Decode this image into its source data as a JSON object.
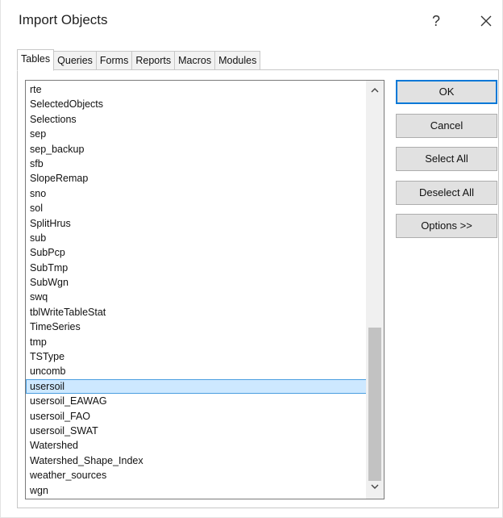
{
  "window": {
    "title": "Import Objects",
    "help_label": "?"
  },
  "tabs": [
    {
      "label": "Tables",
      "active": true
    },
    {
      "label": "Queries",
      "active": false
    },
    {
      "label": "Forms",
      "active": false
    },
    {
      "label": "Reports",
      "active": false
    },
    {
      "label": "Macros",
      "active": false
    },
    {
      "label": "Modules",
      "active": false
    }
  ],
  "list": {
    "items": [
      "rte",
      "SelectedObjects",
      "Selections",
      "sep",
      "sep_backup",
      "sfb",
      "SlopeRemap",
      "sno",
      "sol",
      "SplitHrus",
      "sub",
      "SubPcp",
      "SubTmp",
      "SubWgn",
      "swq",
      "tblWriteTableStat",
      "TimeSeries",
      "tmp",
      "TSType",
      "uncomb",
      "usersoil",
      "usersoil_EAWAG",
      "usersoil_FAO",
      "usersoil_SWAT",
      "Watershed",
      "Watershed_Shape_Index",
      "weather_sources",
      "wgn"
    ],
    "selected": "usersoil"
  },
  "buttons": {
    "ok": "OK",
    "cancel": "Cancel",
    "select_all": "Select All",
    "deselect_all": "Deselect All",
    "options": "Options >>"
  },
  "icons": {
    "close": "close-icon",
    "scroll_up": "chevron-up-icon",
    "scroll_down": "chevron-down-icon"
  },
  "colors": {
    "selection_bg": "#cde8ff",
    "selection_border": "#4a9ee0",
    "default_button_border": "#0078d7"
  }
}
